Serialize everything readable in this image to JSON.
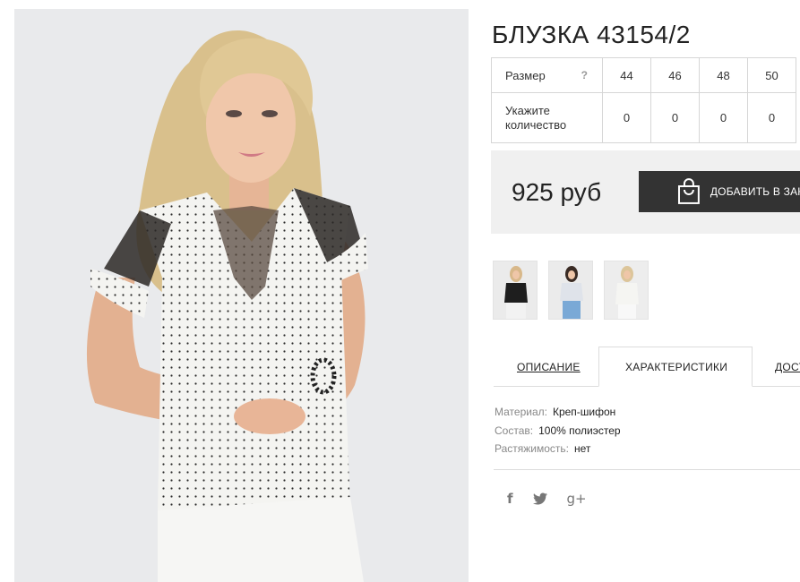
{
  "product": {
    "title": "БЛУЗКА 43154/2",
    "price": "925 руб",
    "add_to_cart": "ДОБАВИТЬ В ЗАКАЗ"
  },
  "sizes": {
    "size_label": "Размер",
    "help": "?",
    "qty_label_1": "Укажите",
    "qty_label_2": "количество",
    "list": [
      {
        "size": "44",
        "qty": "0"
      },
      {
        "size": "46",
        "qty": "0"
      },
      {
        "size": "48",
        "qty": "0"
      },
      {
        "size": "50",
        "qty": "0"
      }
    ]
  },
  "tabs": {
    "description": "ОПИСАНИЕ",
    "characteristics": "ХАРАКТЕРИСТИКИ",
    "delivery": "ДОСТАВКА"
  },
  "characteristics": [
    {
      "key": "Материал:",
      "value": "Креп-шифон"
    },
    {
      "key": "Состав:",
      "value": "100% полиэстер"
    },
    {
      "key": "Растяжимость:",
      "value": "нет"
    }
  ],
  "social": {
    "facebook": "f",
    "twitter": "t",
    "google": "g+"
  },
  "colors": {
    "button_bg": "#333333",
    "price_box_bg": "#f0f0f0",
    "photo_bg": "#e9eaec"
  }
}
